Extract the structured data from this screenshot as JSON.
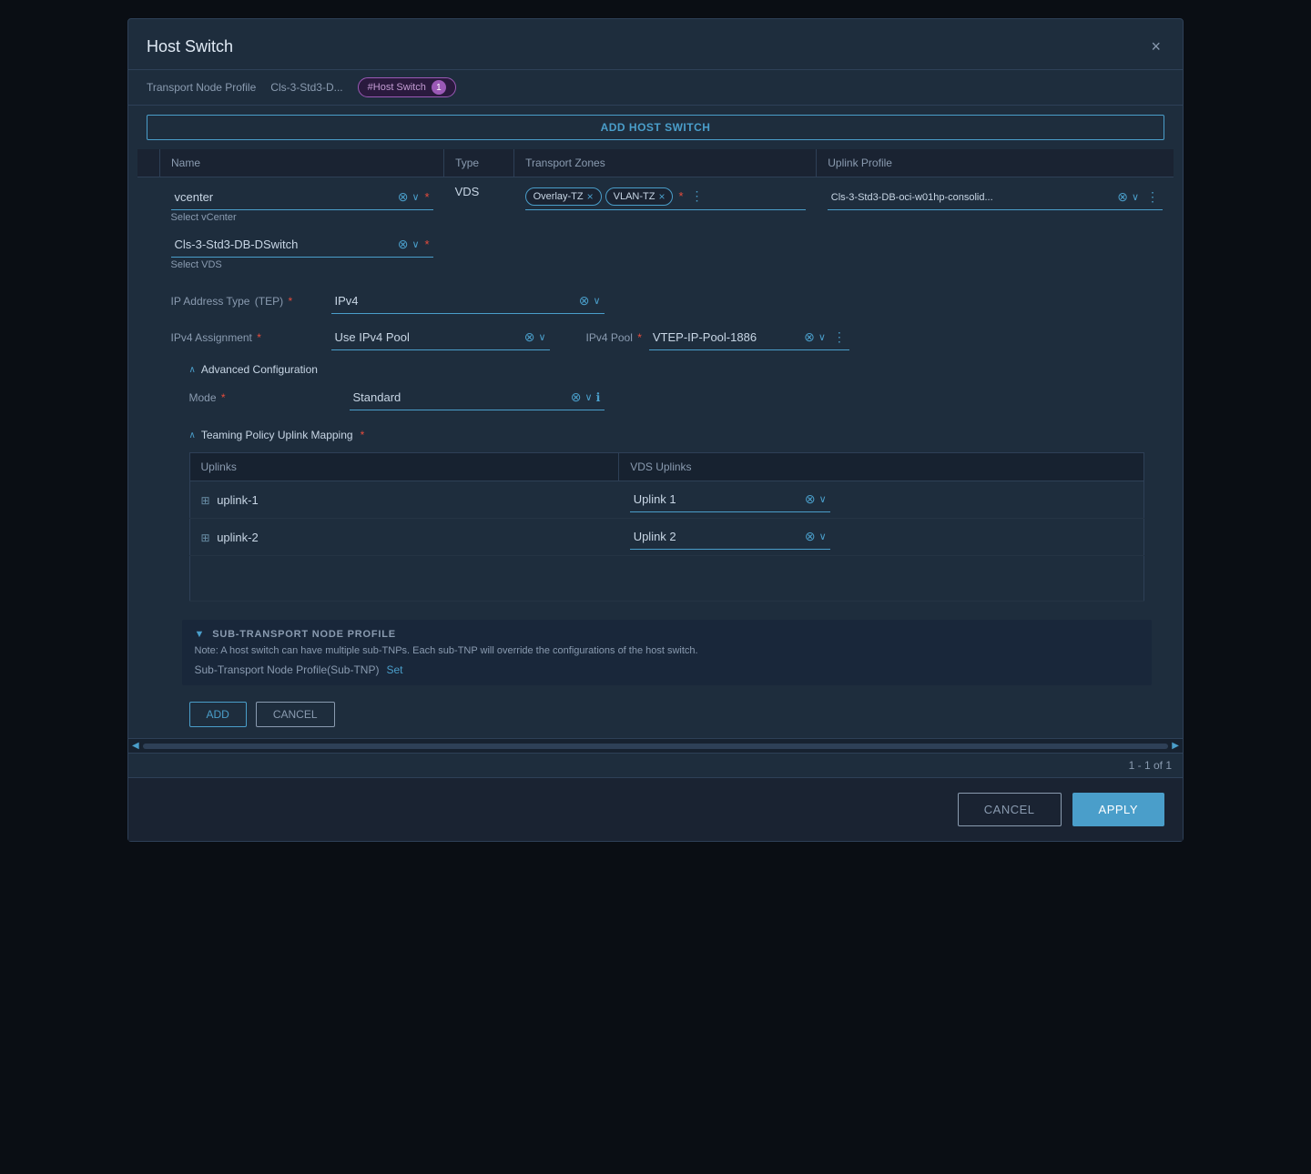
{
  "modal": {
    "title": "Host Switch",
    "close_icon": "×",
    "breadcrumb": {
      "parent": "Transport Node Profile",
      "separator": "",
      "current": "Cls-3-Std3-D..."
    },
    "badge": {
      "label": "#Host Switch",
      "count": "1"
    },
    "add_host_switch_label": "ADD HOST SWITCH"
  },
  "table": {
    "columns": [
      "Name",
      "Type",
      "Transport Zones",
      "Uplink Profile"
    ],
    "row": {
      "indicator_active": true,
      "vcenter_label": "vcenter",
      "select_vcenter": "Select vCenter",
      "type": "VDS",
      "tags": [
        {
          "label": "Overlay-TZ"
        },
        {
          "label": "VLAN-TZ"
        }
      ],
      "uplink_profile": "Cls-3-Std3-DB-oci-w01hp-consolid...",
      "vds_value": "Cls-3-Std3-DB-DSwitch",
      "select_vds": "Select VDS",
      "ip_address_type_label": "IP Address Type",
      "tep_label": "(TEP)",
      "ip_address_type_value": "IPv4",
      "ipv4_assignment_label": "IPv4 Assignment",
      "ipv4_assignment_value": "Use IPv4 Pool",
      "ipv4_pool_label": "IPv4 Pool",
      "ipv4_pool_value": "VTEP-IP-Pool-1886"
    }
  },
  "advanced_config": {
    "label": "Advanced Configuration",
    "mode_label": "Mode",
    "mode_value": "Standard"
  },
  "teaming_policy": {
    "label": "Teaming Policy Uplink Mapping",
    "col_uplinks": "Uplinks",
    "col_vds_uplinks": "VDS Uplinks",
    "rows": [
      {
        "uplink": "uplink-1",
        "vds_uplink": "Uplink 1"
      },
      {
        "uplink": "uplink-2",
        "vds_uplink": "Uplink 2"
      }
    ]
  },
  "sub_transport": {
    "title": "SUB-TRANSPORT NODE PROFILE",
    "note": "Note: A host switch can have multiple sub-TNPs. Each sub-TNP will override the configurations of the host switch.",
    "row_label": "Sub-Transport Node Profile(Sub-TNP)",
    "set_link": "Set",
    "collapse_icon": "▼"
  },
  "form_actions": {
    "add_label": "ADD",
    "cancel_label": "CANCEL"
  },
  "pagination": {
    "text": "1 - 1 of 1"
  },
  "footer": {
    "cancel_label": "CANCEL",
    "apply_label": "APPLY"
  }
}
